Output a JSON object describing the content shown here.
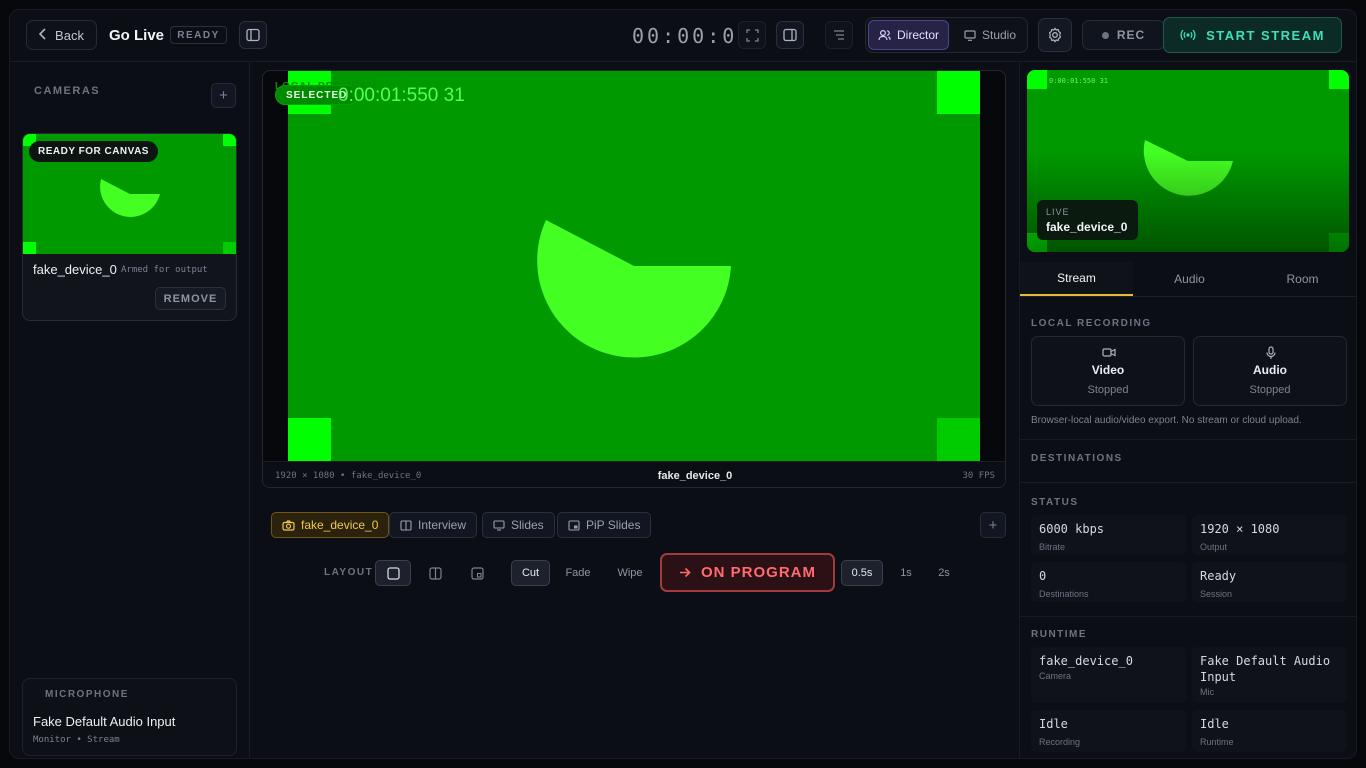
{
  "header": {
    "back_label": "Back",
    "title": "Go Live",
    "status_badge": "READY",
    "timer": "00:00:00",
    "modes": {
      "director": "Director",
      "studio": "Studio"
    },
    "rec_label": "REC",
    "start_stream_label": "START STREAM"
  },
  "cameras": {
    "section_label": "CAMERAS",
    "items": [
      {
        "badge": "READY FOR CANVAS",
        "name": "fake_device_0",
        "status": "Armed for output",
        "remove_label": "REMOVE"
      }
    ]
  },
  "microphone": {
    "section_label": "MICROPHONE",
    "device": "Fake Default Audio Input",
    "routing": "Monitor • Stream"
  },
  "program": {
    "overlay_label": "LOCAL PROGRAM",
    "selected_badge": "SELECTED",
    "timecode": "0:00:01:550 31",
    "footer_resolution": "1920 × 1080 • fake_device_0",
    "footer_source": "fake_device_0",
    "footer_fps": "30 FPS"
  },
  "scenes": [
    {
      "label": "fake_device_0",
      "active": true
    },
    {
      "label": "Interview",
      "active": false
    },
    {
      "label": "Slides",
      "active": false
    },
    {
      "label": "PiP Slides",
      "active": false
    }
  ],
  "controls": {
    "layout_label": "LAYOUT",
    "transitions": [
      "Cut",
      "Fade",
      "Wipe"
    ],
    "on_program_label": "ON PROGRAM",
    "durations": [
      "0.5s",
      "1s",
      "2s"
    ]
  },
  "live_preview": {
    "timecode": "0:00:01:550 31",
    "live_label": "LIVE",
    "source": "fake_device_0"
  },
  "tabs": [
    "Stream",
    "Audio",
    "Room"
  ],
  "local_recording": {
    "section_label": "LOCAL RECORDING",
    "video": {
      "title": "Video",
      "status": "Stopped"
    },
    "audio": {
      "title": "Audio",
      "status": "Stopped"
    },
    "note": "Browser-local audio/video export. No stream or cloud upload."
  },
  "destinations": {
    "section_label": "DESTINATIONS"
  },
  "status": {
    "section_label": "STATUS",
    "items": [
      {
        "value": "6000 kbps",
        "label": "Bitrate"
      },
      {
        "value": "1920 × 1080",
        "label": "Output"
      },
      {
        "value": "0",
        "label": "Destinations"
      },
      {
        "value": "Ready",
        "label": "Session"
      }
    ]
  },
  "runtime": {
    "section_label": "RUNTIME",
    "items": [
      {
        "value": "fake_device_0",
        "label": "Camera"
      },
      {
        "value": "Fake Default Audio Input",
        "label": "Mic"
      },
      {
        "value": "Idle",
        "label": "Recording"
      },
      {
        "value": "Idle",
        "label": "Runtime"
      }
    ]
  },
  "colors": {
    "accent_director": "#4b4590",
    "start_stream": "#3ee0b8",
    "on_program": "#ff6b6e",
    "video_green": "#009900",
    "tab_underline": "#e9b93a"
  }
}
